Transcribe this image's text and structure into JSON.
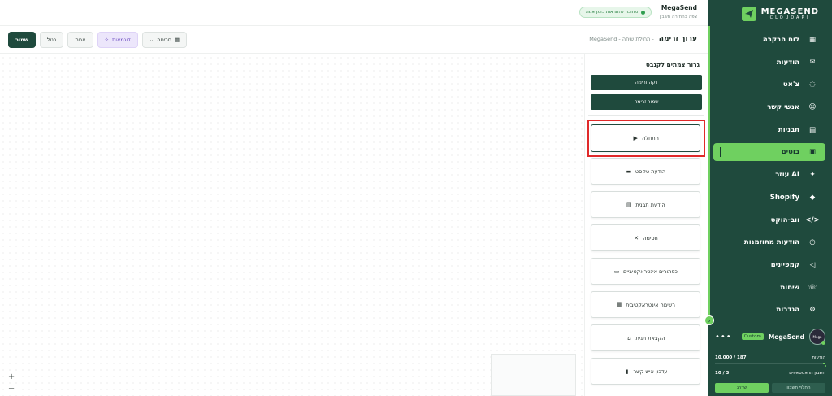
{
  "brand": {
    "name": "MEGASEND",
    "sub": "CLOUDAPI"
  },
  "nav": [
    {
      "label": "לוח הבקרה",
      "icon": "dashboard-icon",
      "glyph": "▦"
    },
    {
      "label": "הודעות",
      "icon": "mail-icon",
      "glyph": "✉"
    },
    {
      "label": "צ'אט",
      "icon": "chat-icon",
      "glyph": "◌"
    },
    {
      "label": "אנשי קשר",
      "icon": "contacts-icon",
      "glyph": "☺"
    },
    {
      "label": "תבניות",
      "icon": "template-icon",
      "glyph": "▤"
    },
    {
      "label": "בוטים",
      "icon": "bot-icon",
      "glyph": "▣",
      "active": true
    },
    {
      "label": "עוזר AI",
      "icon": "sparkle-icon",
      "glyph": "✦"
    },
    {
      "label": "Shopify",
      "icon": "shopify-icon",
      "glyph": "◆"
    },
    {
      "label": "ווב-הוקס",
      "icon": "code-icon",
      "glyph": "</>"
    },
    {
      "label": "הודעות מתוזמנות",
      "icon": "clock-icon",
      "glyph": "◷"
    },
    {
      "label": "קמפיינים",
      "icon": "megaphone-icon",
      "glyph": "◁"
    },
    {
      "label": "שיחות",
      "icon": "phone-icon",
      "glyph": "☏"
    },
    {
      "label": "הגדרות",
      "icon": "gear-icon",
      "glyph": "⚙"
    }
  ],
  "account": {
    "name": "MegaSend",
    "badge": "Custom",
    "more": "•••",
    "avatar_text": "Mega",
    "messages_label": "הודעות",
    "messages_value": "10,000 / 187",
    "messages_fraction": 0.0187,
    "accounts_label": "חשבון הוואטסאפים",
    "accounts_value": "10 / 3",
    "switch_label": "החלף חשבון",
    "upgrade_label": "שדרג"
  },
  "topbar": {
    "org_name": "MegaSend",
    "org_sub": "צפה בהחזרה חשבון",
    "connection": "מחובר להתראות בזמן אמת"
  },
  "editor": {
    "title": "ערוך זרימה",
    "subtitle": "- תחילת שיחה - MegaSend",
    "save": "שמור",
    "cancel": "בטל",
    "verify": "אמת",
    "examples": "דוגמאות",
    "series": "סריסה"
  },
  "panel": {
    "title": "גרור צמתים לקנבס",
    "clear": "נקה זרימה",
    "save": "שמור זרימה",
    "nodes": [
      {
        "label": "התחלה",
        "icon": "play-icon",
        "glyph": "▶"
      },
      {
        "label": "הודעת טקסט",
        "icon": "message-icon",
        "glyph": "▬"
      },
      {
        "label": "הודעת תבנית",
        "icon": "template-file-icon",
        "glyph": "▤"
      },
      {
        "label": "חסימה",
        "icon": "block-icon",
        "glyph": "✕"
      },
      {
        "label": "כפתורים אינטראקטיביים",
        "icon": "buttons-icon",
        "glyph": "▭"
      },
      {
        "label": "רשימה אינטראקטיבית",
        "icon": "list-icon",
        "glyph": "▦"
      },
      {
        "label": "הקצאת תגית",
        "icon": "bank-icon",
        "glyph": "⌂"
      },
      {
        "label": "עדכון איש קשר",
        "icon": "book-icon",
        "glyph": "▮"
      }
    ]
  },
  "zoom": {
    "in": "+",
    "out": "−"
  }
}
